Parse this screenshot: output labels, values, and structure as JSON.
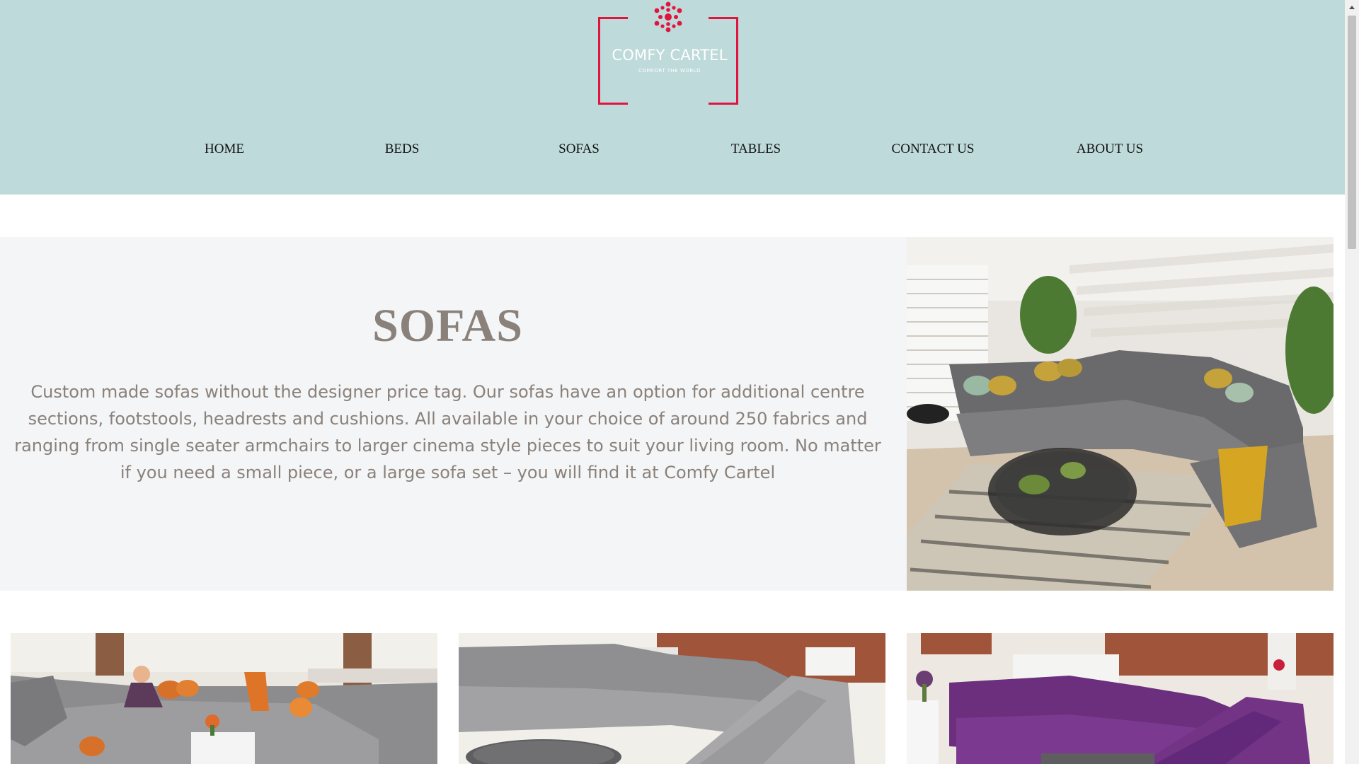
{
  "brand": {
    "name": "COMFY CARTEL",
    "tagline": "COMFORT THE WORLD",
    "accent_color": "#e0143c",
    "header_bg": "#bfdadb"
  },
  "nav": {
    "items": [
      "HOME",
      "BEDS",
      "SOFAS",
      "TABLES",
      "CONTACT US",
      "ABOUT US"
    ]
  },
  "hero": {
    "title": "SOFAS",
    "description": "Custom made sofas without the designer price tag. Our sofas have an option for additional centre sections, footstools, headrests and cushions. All available in your choice of around 250 fabrics and ranging from single seater armchairs to larger cinema style pieces to suit your living room. No matter if you need a small piece, or a large sofa set – you will find it at Comfy Cartel",
    "text_color": "#8a817b",
    "image": "grey-corner-sofa-living-room-photo"
  },
  "products": [
    {
      "image": "grey-velvet-u-sofa-orange-cushions-photo"
    },
    {
      "image": "grey-fabric-u-sofa-photo"
    },
    {
      "image": "purple-u-sofa-photo"
    }
  ],
  "icons": {
    "logo_emblem": "red-snowflake-emblem-icon",
    "scroll_up": "scroll-up-arrow-icon"
  }
}
